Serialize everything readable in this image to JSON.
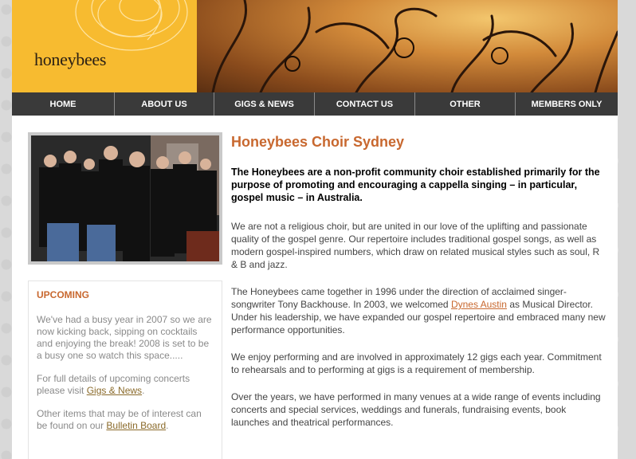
{
  "header": {
    "logo": "honeybees"
  },
  "nav": {
    "items": [
      {
        "label": "HOME"
      },
      {
        "label": "ABOUT US"
      },
      {
        "label": "GIGS & NEWS"
      },
      {
        "label": "CONTACT US"
      },
      {
        "label": "OTHER"
      },
      {
        "label": "MEMBERS ONLY"
      }
    ]
  },
  "sidebar": {
    "upcoming_title": "UPCOMING",
    "para1": "We've had a busy year in 2007 so we are now kicking back, sipping on cocktails and enjoying the break! 2008 is set to be a busy one so watch this space.....",
    "para2_before": "For full details of upcoming concerts please visit ",
    "para2_link": "Gigs & News",
    "para2_after": ".",
    "para3_before": "Other items that may be of interest can be found on our ",
    "para3_link": "Bulletin Board",
    "para3_after": "."
  },
  "main": {
    "title": "Honeybees Choir Sydney",
    "lead": "The Honeybees are a non-profit community choir established primarily for the purpose of promoting and encouraging a cappella singing – in particular, gospel music – in Australia.",
    "p1": "We are not a religious choir, but are united in our love of the uplifting and passionate quality of the gospel genre.  Our repertoire includes traditional gospel songs, as well as modern gospel-inspired numbers, which draw on related musical styles such as soul, R & B and jazz.",
    "p2_before": "The Honeybees came together in 1996 under the direction of acclaimed singer-songwriter Tony Backhouse.  In 2003, we welcomed ",
    "p2_link": "Dynes Austin",
    "p2_after": " as Musical Director. Under his leadership, we have expanded our gospel repertoire and embraced many new performance opportunities.",
    "p3": "We enjoy performing and are involved in approximately 12 gigs each year. Commitment to rehearsals and to performing at gigs is a requirement of membership.",
    "p4": "Over the years, we have performed in many venues at a wide range of events including concerts and special services, weddings and funerals, fundraising events, book launches and theatrical performances."
  },
  "colors": {
    "accent": "#c8682f",
    "header_yellow": "#f7bb30",
    "nav_bg": "#3a3a3a"
  }
}
